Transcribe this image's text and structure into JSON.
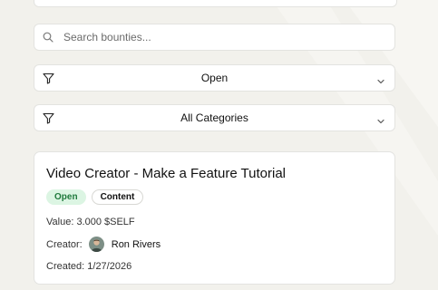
{
  "search": {
    "placeholder": "Search bounties..."
  },
  "filters": {
    "status": "Open",
    "category": "All Categories"
  },
  "bounty": {
    "title": "Video Creator - Make a Feature Tutorial",
    "status_badge": "Open",
    "category_badge": "Content",
    "value_label": "Value:",
    "value": "3.000 $SELF",
    "creator_label": "Creator:",
    "creator_name": "Ron Rivers",
    "created_label": "Created:",
    "created_date": "1/27/2026"
  },
  "colors": {
    "background": "#f2f1ec",
    "open_badge_bg": "#dcf5e3",
    "open_badge_text": "#1f7a3c"
  }
}
